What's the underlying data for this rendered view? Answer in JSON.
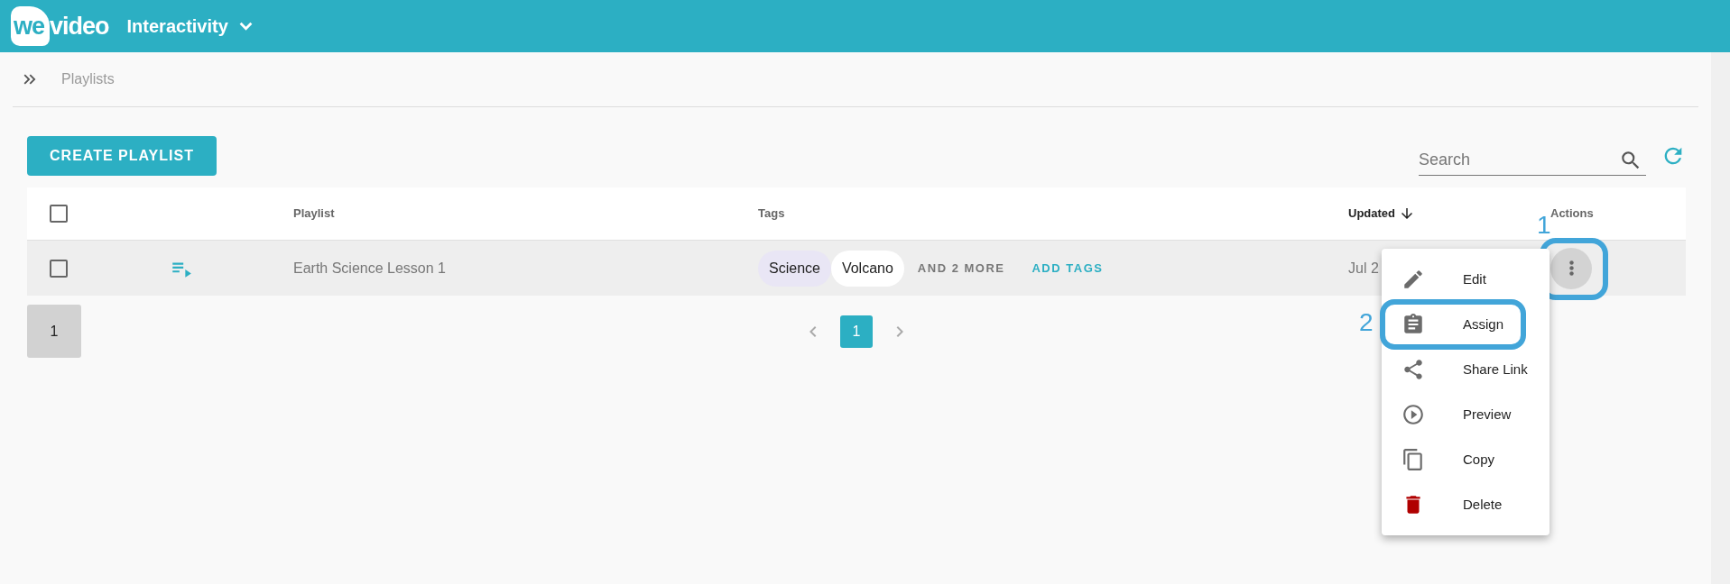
{
  "header": {
    "logo_mark": "we",
    "logo_text": "video",
    "title": "Interactivity"
  },
  "breadcrumb": [
    "Playlists"
  ],
  "toolbar": {
    "create_button": "CREATE PLAYLIST",
    "search": {
      "placeholder": "Search"
    }
  },
  "table": {
    "select_all_checked": false,
    "columns": [
      {
        "label": "Playlist",
        "sorted": false
      },
      {
        "label": "Tags",
        "sorted": false
      },
      {
        "label": "Updated",
        "sorted": true
      },
      {
        "label": "Actions",
        "sorted": false
      }
    ],
    "rows": [
      {
        "checked": false,
        "playlist": "Earth Science Lesson 1",
        "tags": [
          {
            "label": "Science",
            "color": "#e9e6f5"
          },
          {
            "label": "Volcano",
            "color": "#ffffff"
          }
        ],
        "more_tags": "AND 2 MORE",
        "add_tags": "ADD TAGS",
        "updated": "Jul 2",
        "actions_callout": "1"
      }
    ]
  },
  "pagination": {
    "page_size": "1",
    "pages": [
      {
        "label": "1",
        "selected": true
      }
    ]
  },
  "menu": {
    "items": [
      {
        "label": "Edit",
        "kind": "edit"
      },
      {
        "label": "Assign",
        "kind": "assign",
        "callout": "2"
      },
      {
        "label": "Share Link",
        "kind": "share"
      },
      {
        "label": "Preview",
        "kind": "preview"
      },
      {
        "label": "Copy",
        "kind": "copy"
      },
      {
        "label": "Delete",
        "kind": "delete"
      }
    ]
  }
}
